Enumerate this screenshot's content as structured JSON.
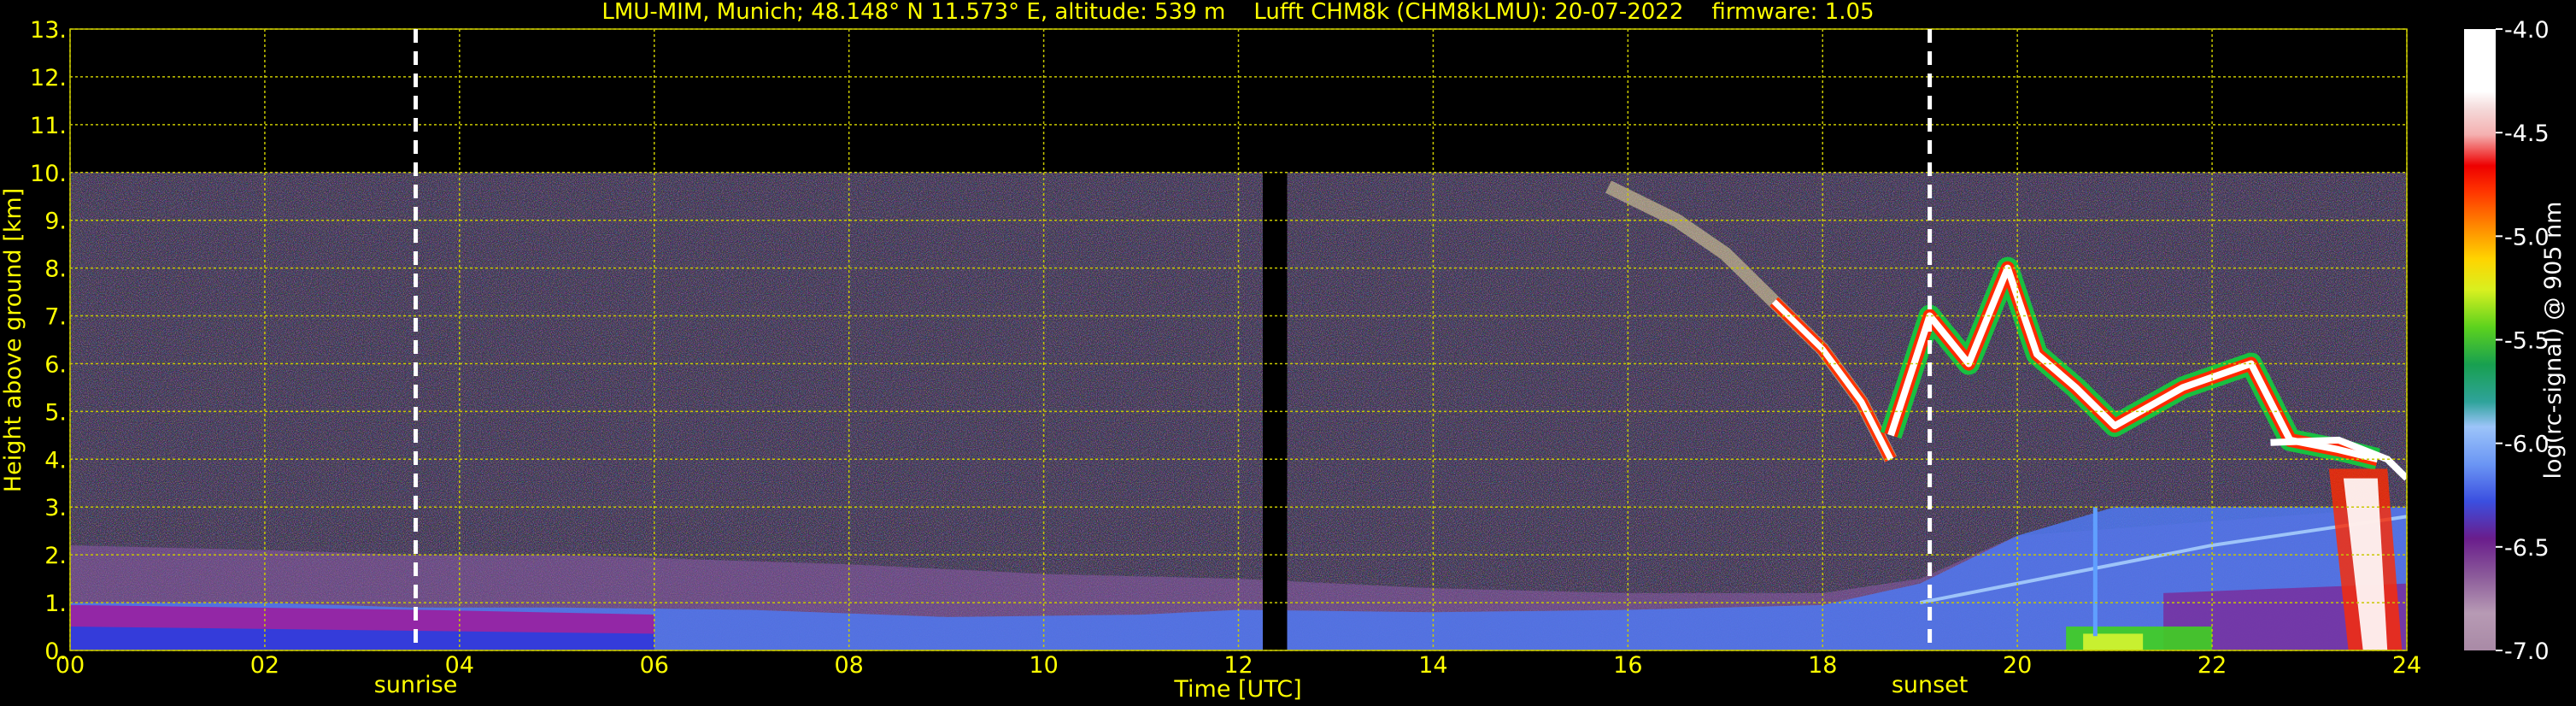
{
  "chart_data": {
    "type": "heatmap",
    "title": "LMU-MIM, Munich; 48.148° N 11.573° E, altitude: 539 m    Lufft CHM8k (CHM8kLMU): 20-07-2022    firmware: 1.05",
    "xlabel": "Time [UTC]",
    "ylabel": "Height above ground [km]",
    "xlim": [
      0,
      24
    ],
    "ylim": [
      0,
      13
    ],
    "x_ticks": [
      "00",
      "02",
      "04",
      "06",
      "08",
      "10",
      "12",
      "14",
      "16",
      "18",
      "20",
      "22",
      "24"
    ],
    "y_ticks": [
      "0.",
      "1.",
      "2.",
      "3.",
      "4.",
      "5.",
      "6.",
      "7.",
      "8.",
      "9.",
      "10.",
      "11.",
      "12.",
      "13."
    ],
    "grid": true,
    "data_ceiling_km": 10,
    "missing_data_interval_h": [
      12.25,
      12.5
    ],
    "colorbar": {
      "label": "log(rc-signal) @ 905 nm",
      "range": [
        -7.0,
        -4.0
      ],
      "ticks": [
        "-4.0",
        "-4.5",
        "-5.0",
        "-5.5",
        "-6.0",
        "-6.5",
        "-7.0"
      ],
      "colors": [
        "#a98aa6",
        "#b79ab4",
        "#9a6f9f",
        "#8b5a9a",
        "#7a3c93",
        "#6a1d8c",
        "#4a2fb0",
        "#3b4fe0",
        "#4f78f0",
        "#6b96f4",
        "#83aef7",
        "#9cc4f9",
        "#2fa39b",
        "#1fb494",
        "#18a050",
        "#26c02a",
        "#5cd21e",
        "#a0e32c",
        "#d8f020",
        "#f2f018",
        "#ffd400",
        "#ffb000",
        "#ff8c00",
        "#ff6600",
        "#ff3300",
        "#ee1010",
        "#ee0000",
        "#f4b0b0",
        "#f4d8d8",
        "#ffffff",
        "#ffffff"
      ]
    },
    "annotations": [
      {
        "label": "sunrise",
        "x": 3.55
      },
      {
        "label": "sunset",
        "x": 19.1
      }
    ],
    "features": {
      "boundary_layer_top_km": [
        [
          0,
          1.0
        ],
        [
          2,
          1.0
        ],
        [
          3.5,
          0.9
        ],
        [
          5,
          0.9
        ],
        [
          7,
          0.85
        ],
        [
          9,
          0.7
        ],
        [
          11,
          0.75
        ],
        [
          12,
          0.85
        ],
        [
          14,
          0.8
        ],
        [
          16,
          0.85
        ],
        [
          18,
          0.95
        ],
        [
          19,
          1.4
        ],
        [
          20,
          2.4
        ],
        [
          21,
          3.0
        ],
        [
          22,
          3.0
        ],
        [
          23,
          3.0
        ],
        [
          24,
          3.0
        ]
      ],
      "residual_layer_km": [
        [
          0,
          2.2
        ],
        [
          2,
          2.1
        ],
        [
          3.5,
          2.0
        ],
        [
          5,
          2.0
        ],
        [
          6.5,
          1.9
        ],
        [
          8,
          1.8
        ],
        [
          10,
          1.6
        ],
        [
          12,
          1.5
        ],
        [
          14,
          1.3
        ],
        [
          16,
          1.2
        ],
        [
          18,
          1.2
        ],
        [
          19,
          1.5
        ],
        [
          20,
          2.4
        ],
        [
          24,
          3.0
        ]
      ],
      "cirrus_band_km": [
        [
          15.8,
          9.7
        ],
        [
          16.5,
          9.0
        ],
        [
          17,
          8.3
        ],
        [
          17.5,
          7.3
        ],
        [
          18,
          6.3
        ],
        [
          18.4,
          5.2
        ],
        [
          18.7,
          4.0
        ]
      ],
      "convective_clouds_km": [
        [
          18.7,
          4.5
        ],
        [
          19.1,
          7.0
        ],
        [
          19.5,
          6.0
        ],
        [
          19.9,
          8.0
        ],
        [
          20.2,
          6.2
        ],
        [
          20.6,
          5.5
        ],
        [
          21.0,
          4.7
        ],
        [
          21.7,
          5.5
        ],
        [
          22.4,
          6.0
        ],
        [
          22.8,
          4.4
        ],
        [
          23.3,
          4.2
        ],
        [
          23.7,
          4.0
        ]
      ],
      "low_cloud_km": [
        [
          20.5,
          0.4
        ],
        [
          22.0,
          0.3
        ]
      ],
      "rain_shaft_h": [
        23.2,
        23.8
      ]
    }
  }
}
